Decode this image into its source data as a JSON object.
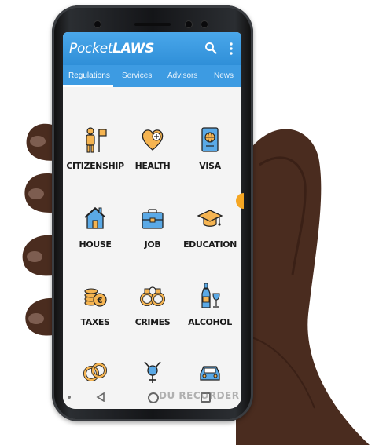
{
  "app": {
    "logo_part1": "Pocket",
    "logo_part2": "LAWS"
  },
  "tabs": [
    {
      "label": "Regulations"
    },
    {
      "label": "Services"
    },
    {
      "label": "Advisors"
    },
    {
      "label": "News"
    }
  ],
  "categories": [
    {
      "label": "CITIZENSHIP",
      "icon": "citizenship-icon"
    },
    {
      "label": "HEALTH",
      "icon": "health-icon"
    },
    {
      "label": "VISA",
      "icon": "passport-icon"
    },
    {
      "label": "HOUSE",
      "icon": "house-icon"
    },
    {
      "label": "JOB",
      "icon": "briefcase-icon"
    },
    {
      "label": "EDUCATION",
      "icon": "graduation-cap-icon"
    },
    {
      "label": "TAXES",
      "icon": "coins-icon"
    },
    {
      "label": "CRIMES",
      "icon": "handcuffs-icon"
    },
    {
      "label": "ALCOHOL",
      "icon": "wine-bottle-icon"
    },
    {
      "label": "",
      "icon": "rings-icon"
    },
    {
      "label": "",
      "icon": "gender-icon"
    },
    {
      "label": "",
      "icon": "car-icon"
    }
  ],
  "watermark": "DU RECORDER",
  "colors": {
    "appbar": "#3a9be3",
    "icon_orange": "#f5b451",
    "icon_blue": "#5aa9e6"
  }
}
